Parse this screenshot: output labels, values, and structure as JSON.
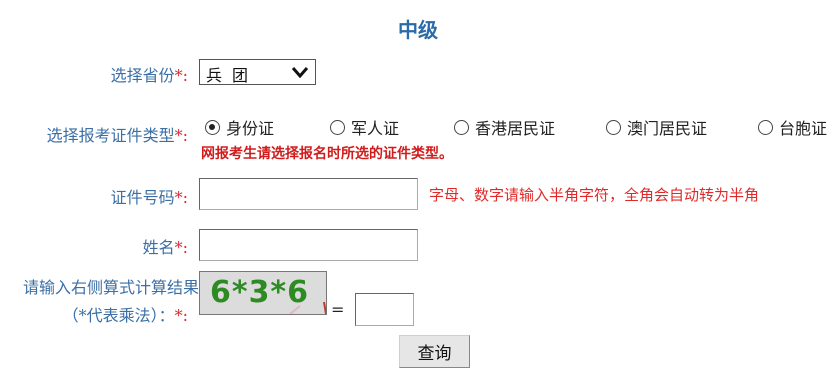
{
  "title": "中级",
  "province": {
    "label": "选择省份",
    "required_mark": "*:",
    "selected": "兵团"
  },
  "id_type": {
    "label": "选择报考证件类型",
    "required_mark": "*:",
    "options": [
      "身份证",
      "军人证",
      "香港居民证",
      "澳门居民证",
      "台胞证"
    ],
    "selected": "身份证",
    "note": "网报考生请选择报名时所选的证件类型。"
  },
  "id_number": {
    "label": "证件号码",
    "required_mark": "*:",
    "value": "",
    "hint": "字母、数字请输入半角字符，全角会自动转为半角"
  },
  "name": {
    "label": "姓名",
    "required_mark": "*:",
    "value": ""
  },
  "captcha": {
    "label_line1": "请输入右侧算式计算结果",
    "label_line2": "（*代表乘法）：",
    "required_mark": "*:",
    "image_text": "6*3*6",
    "equals": "=",
    "answer": ""
  },
  "submit_label": "查询",
  "colors": {
    "label": "#3b6fa6",
    "required": "#e0262c",
    "title": "#2a6aa9",
    "captcha_text": "#2e8a23"
  }
}
